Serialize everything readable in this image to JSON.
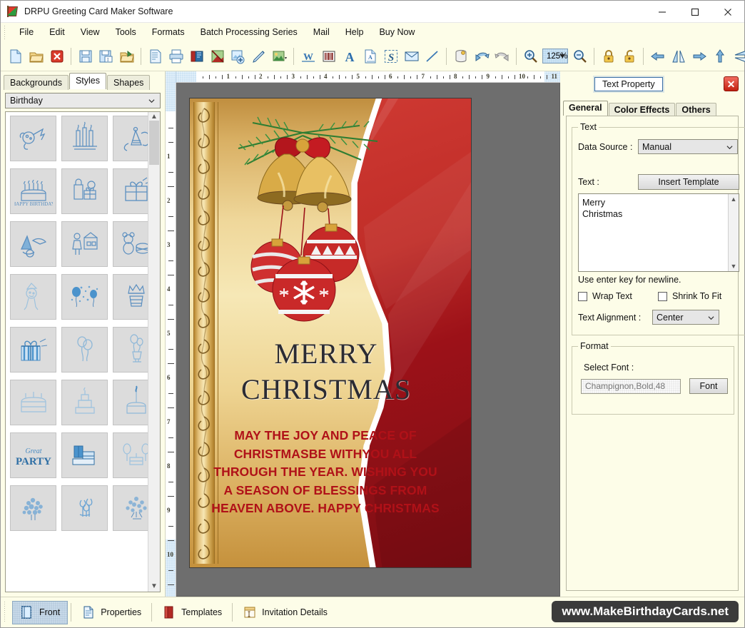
{
  "window": {
    "title": "DRPU Greeting Card Maker Software",
    "icon": "app-flag-icon",
    "controls": {
      "minimize": "–",
      "maximize": "□",
      "close": "✕"
    }
  },
  "menubar": {
    "items": [
      "File",
      "Edit",
      "View",
      "Tools",
      "Formats",
      "Batch Processing Series",
      "Mail",
      "Help",
      "Buy Now"
    ]
  },
  "toolbar": {
    "zoom_value": "125%",
    "buttons": [
      "new-document-icon",
      "open-folder-icon",
      "close-document-icon",
      "save-icon",
      "save-as-icon",
      "open-recent-icon",
      "page-setup-icon",
      "print-icon",
      "print-preview-icon",
      "card-design-icon",
      "insert-image-icon",
      "draw-pen-icon",
      "picture-shape-icon",
      "watermark-icon",
      "barcode-icon",
      "text-icon",
      "text-box-icon",
      "signature-icon",
      "envelope-icon",
      "line-icon",
      "database-icon",
      "undo-icon",
      "redo-icon",
      "zoom-in-icon",
      "zoom-out-icon",
      "lock-icon",
      "unlock-icon",
      "align-left-icon",
      "align-center-horizontal-icon",
      "align-right-icon",
      "align-top-icon",
      "align-center-vertical-icon",
      "align-bottom-icon"
    ]
  },
  "left_panel": {
    "tabs": [
      {
        "label": "Backgrounds",
        "active": false
      },
      {
        "label": "Styles",
        "active": true
      },
      {
        "label": "Shapes",
        "active": false
      }
    ],
    "category": "Birthday",
    "thumbnails": [
      "party-blower-icon",
      "birthday-candles-icon",
      "party-hat-streamers-icon",
      "happy-birthday-cake-icon",
      "gift-bag-presents-icon",
      "wrapped-gift-icon",
      "toy-boat-plane-icon",
      "girl-with-dollhouse-icon",
      "teddy-bear-drum-icon",
      "party-clown-icon",
      "balloons-confetti-icon",
      "birthday-crown-cake-icon",
      "striped-gift-box-icon",
      "two-balloons-icon",
      "balloon-bouquet-icon",
      "layer-cake-icon",
      "tiered-cake-icon",
      "candle-cake-icon",
      "great-party-text-icon",
      "gift-pile-icon",
      "cake-with-balloons-icon",
      "flower-bunch-icon",
      "tulip-bouquet-icon",
      "floral-arrangement-icon"
    ],
    "scroll_up": "▲",
    "scroll_down": "▼"
  },
  "canvas": {
    "h_ruler_labels": [
      "1",
      "2",
      "3",
      "4",
      "5",
      "6",
      "7",
      "8",
      "9",
      "10",
      "11"
    ],
    "v_ruler_labels": [
      "1",
      "2",
      "3",
      "4",
      "5",
      "6",
      "7",
      "8",
      "9",
      "10"
    ],
    "card": {
      "heading_line1": "MERRY",
      "heading_line2": "CHRISTMAS",
      "body": "MAY THE JOY AND PEACE OF\nCHRISTMASBE WITHYOU\nALL THROUGH THE YEAR.\nWISHING YOU A SEASON\nOF BLESSINGS\nFROM HEAVEN ABOVE.\nHAPPY CHRISTMAS",
      "artwork": [
        "christmas-bells-icon",
        "pine-branches-icon",
        "red-ornament-balls-icon"
      ],
      "colors": {
        "gold": "#efd79a",
        "red": "#9c1118",
        "heading": "#2b2b33",
        "body_text": "#b01118"
      }
    }
  },
  "text_property": {
    "title": "Text Property",
    "close_label": "✕",
    "tabs": [
      {
        "label": "General",
        "active": true
      },
      {
        "label": "Color Effects",
        "active": false
      },
      {
        "label": "Others",
        "active": false
      }
    ],
    "text_group": {
      "legend": "Text",
      "data_source_label": "Data Source :",
      "data_source_value": "Manual",
      "data_source_options": [
        "Manual"
      ],
      "text_label": "Text :",
      "insert_template_label": "Insert Template",
      "textarea_value": "Merry\nChristmas",
      "hint": "Use enter key for newline.",
      "wrap_text_label": "Wrap Text",
      "wrap_text_checked": false,
      "shrink_to_fit_label": "Shrink To Fit",
      "shrink_to_fit_checked": false,
      "alignment_label": "Text Alignment :",
      "alignment_value": "Center",
      "alignment_options": [
        "Center"
      ]
    },
    "format_group": {
      "legend": "Format",
      "select_font_label": "Select Font :",
      "font_value": "Champignon,Bold,48",
      "font_button_label": "Font"
    }
  },
  "statusbar": {
    "items": [
      {
        "label": "Front",
        "icon": "card-front-icon",
        "active": true
      },
      {
        "label": "Properties",
        "icon": "properties-icon",
        "active": false
      },
      {
        "label": "Templates",
        "icon": "templates-icon",
        "active": false
      },
      {
        "label": "Invitation Details",
        "icon": "invitation-details-icon",
        "active": false
      }
    ],
    "url": "www.MakeBirthdayCards.net"
  }
}
